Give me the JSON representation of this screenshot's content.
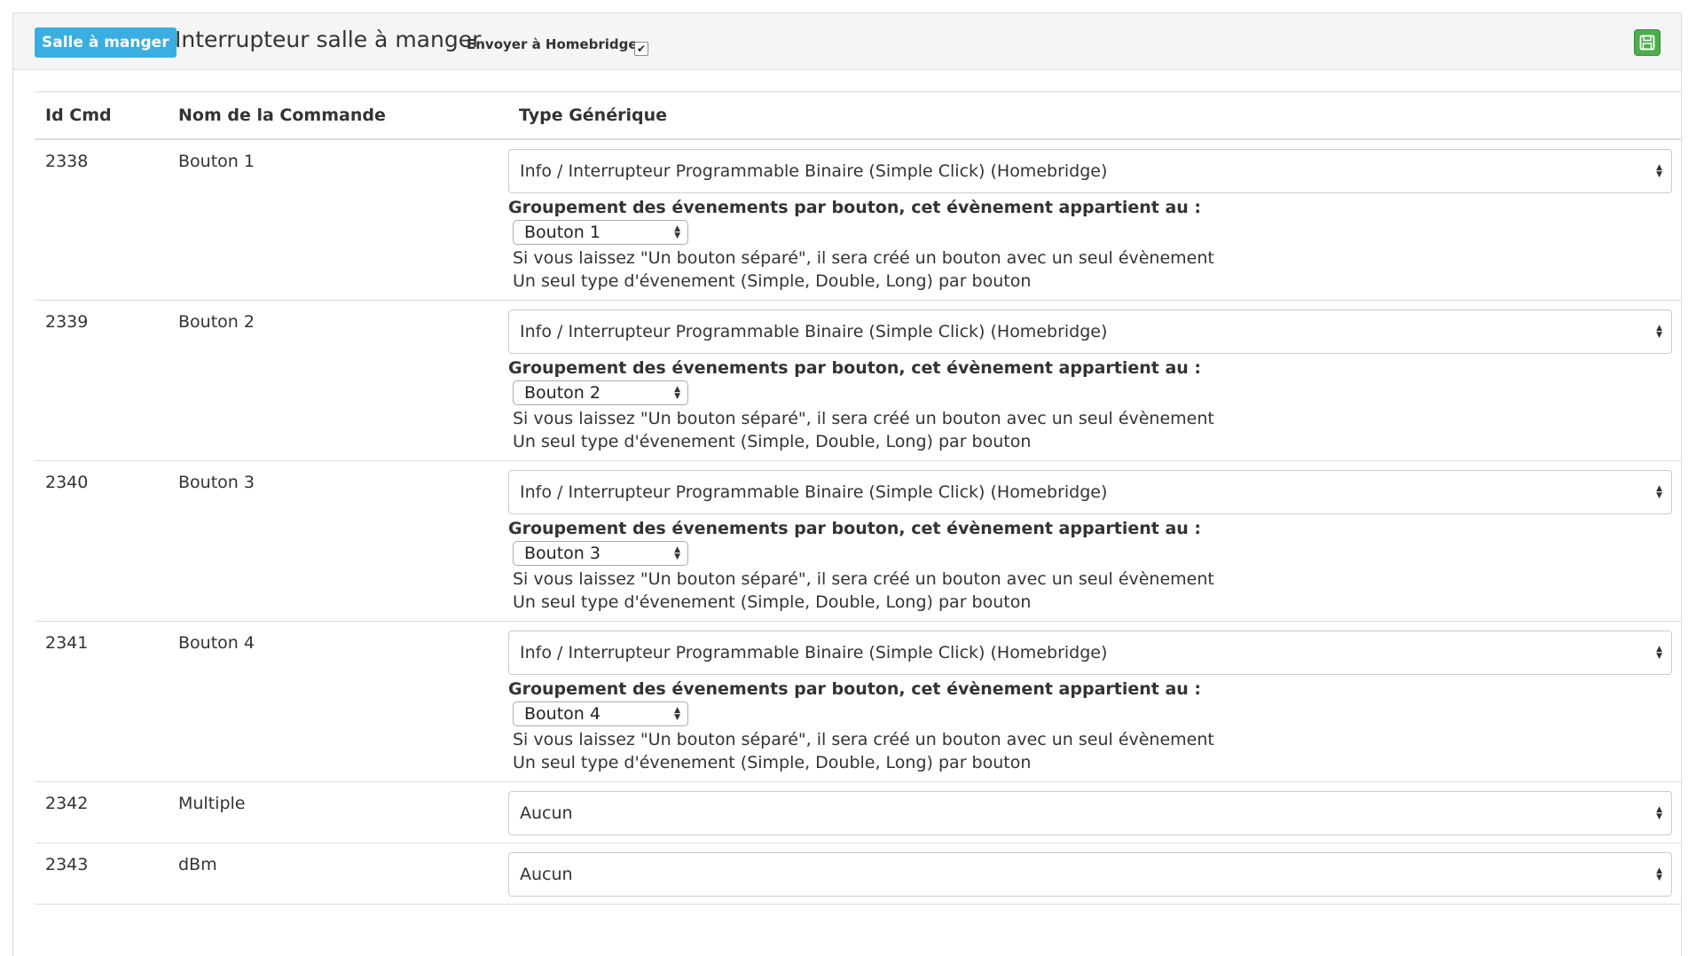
{
  "header": {
    "badge": "Salle à manger",
    "title": "Interrupteur salle à manger",
    "homebridge_label": "Envoyer à Homebridge",
    "homebridge_checked": true,
    "save_icon": "floppy-disk-icon",
    "save_color": "#4cae4c",
    "badge_color": "#3aaee0"
  },
  "table": {
    "columns": [
      "Id Cmd",
      "Nom de la Commande",
      "Type Générique"
    ],
    "group_label": "Groupement des évenements par bouton, cet évènement appartient au :",
    "help_line1": "Si vous laissez \"Un bouton séparé\", il sera créé un bouton avec un seul évènement",
    "help_line2": "Un seul type d'évenement (Simple, Double, Long) par bouton",
    "rows": [
      {
        "id": "2338",
        "name": "Bouton 1",
        "type": "Info / Interrupteur Programmable Binaire (Simple Click) (Homebridge)",
        "group": "Bouton 1"
      },
      {
        "id": "2339",
        "name": "Bouton 2",
        "type": "Info / Interrupteur Programmable Binaire (Simple Click) (Homebridge)",
        "group": "Bouton 2"
      },
      {
        "id": "2340",
        "name": "Bouton 3",
        "type": "Info / Interrupteur Programmable Binaire (Simple Click) (Homebridge)",
        "group": "Bouton 3"
      },
      {
        "id": "2341",
        "name": "Bouton 4",
        "type": "Info / Interrupteur Programmable Binaire (Simple Click) (Homebridge)",
        "group": "Bouton 4"
      },
      {
        "id": "2342",
        "name": "Multiple",
        "type": "Aucun"
      },
      {
        "id": "2343",
        "name": "dBm",
        "type": "Aucun"
      }
    ]
  }
}
